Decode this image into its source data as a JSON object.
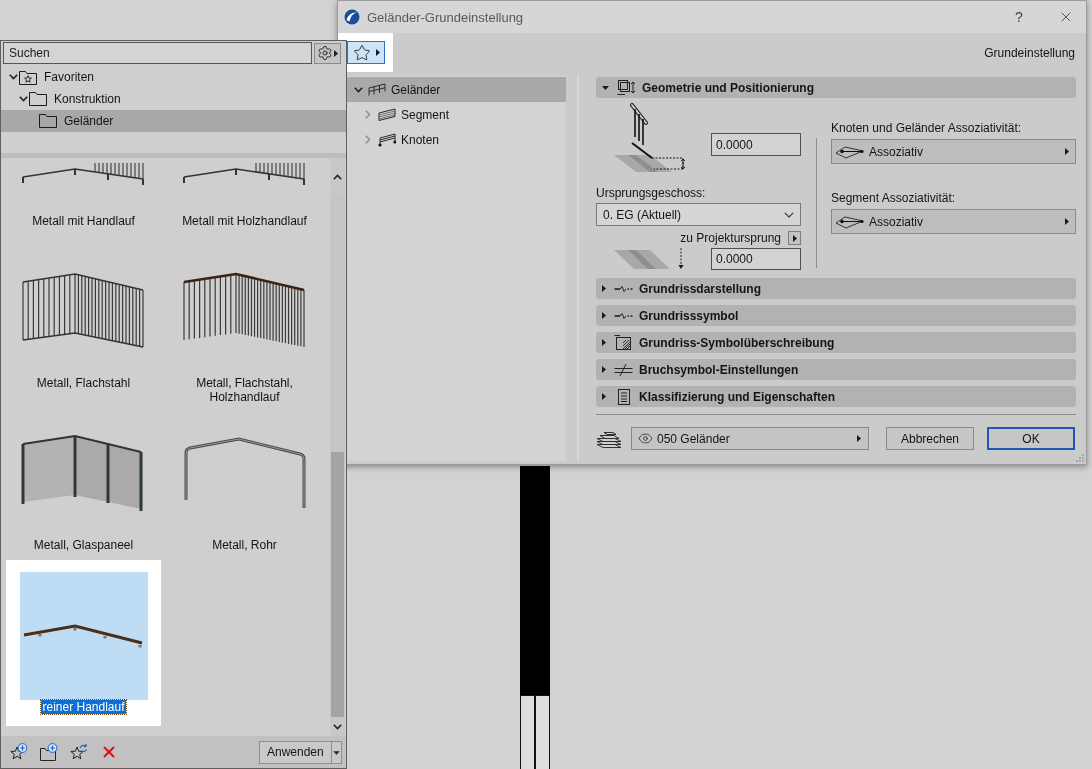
{
  "palette": {
    "search": {
      "placeholder": "Suchen"
    },
    "tree": [
      {
        "label": "Favoriten",
        "kind": "favorites",
        "expanded": true,
        "selected": false,
        "children": [
          {
            "label": "Konstruktion",
            "kind": "folder",
            "expanded": true,
            "selected": false,
            "children": [
              {
                "label": "Geländer",
                "kind": "folder",
                "selected": true
              }
            ]
          }
        ]
      }
    ],
    "thumbnails": [
      {
        "label": "Metall mit Handlauf",
        "kind": "partial",
        "selected": false
      },
      {
        "label": "Metall mit Holzhandlauf",
        "kind": "partial",
        "selected": false
      },
      {
        "label": "Metall, Flachstahl",
        "kind": "bars",
        "selected": false
      },
      {
        "label": "Metall, Flachstahl, Holzhandlauf",
        "kind": "bars-wood",
        "selected": false
      },
      {
        "label": "Metall, Glaspaneel",
        "kind": "glass",
        "selected": false
      },
      {
        "label": "Metall, Rohr",
        "kind": "tube",
        "selected": false
      },
      {
        "label": "reiner Handlauf",
        "kind": "handrail",
        "selected": true
      }
    ],
    "apply_button": "Anwenden"
  },
  "dialog": {
    "title": "Geländer-Grundeinstellung",
    "help": "?",
    "mode_label": "Grundeinstellung",
    "tree": [
      {
        "label": "Geländer",
        "kind": "railing",
        "expanded": true,
        "selected": true,
        "children": [
          {
            "label": "Segment",
            "kind": "segment",
            "expanded": false,
            "selected": false
          },
          {
            "label": "Knoten",
            "kind": "node",
            "expanded": false,
            "selected": false
          }
        ]
      }
    ],
    "sections": [
      {
        "title": "Geometrie und Positionierung",
        "kind": "geometry",
        "expanded": true
      },
      {
        "title": "Grundrissdarstellung",
        "kind": "plan",
        "expanded": false
      },
      {
        "title": "Grundrisssymbol",
        "kind": "plan",
        "expanded": false
      },
      {
        "title": "Grundriss-Symbolüberschreibung",
        "kind": "override",
        "expanded": false
      },
      {
        "title": "Bruchsymbol-Einstellungen",
        "kind": "break",
        "expanded": false
      },
      {
        "title": "Klassifizierung und Eigenschaften",
        "kind": "classification",
        "expanded": false
      }
    ],
    "geometry": {
      "height_value": "0.0000",
      "story_label": "Ursprungsgeschoss:",
      "story_value": "0. EG (Aktuell)",
      "offset_label": "zu Projektursprung",
      "offset_value": "0.0000",
      "associativity": [
        {
          "label": "Knoten und Geländer Assoziativität:",
          "value": "Assoziativ"
        },
        {
          "label": "Segment Assoziativität:",
          "value": "Assoziativ"
        }
      ]
    },
    "layer": "050 Geländer",
    "buttons": [
      {
        "label": "Abbrechen",
        "default": false
      },
      {
        "label": "OK",
        "default": true
      }
    ]
  }
}
